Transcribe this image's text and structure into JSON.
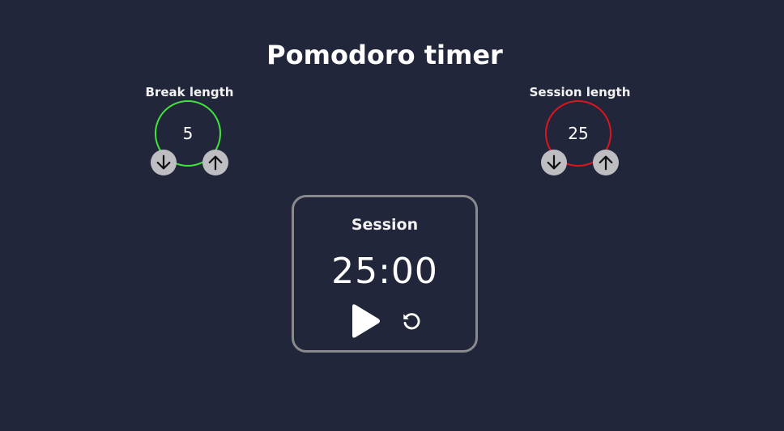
{
  "title": "Pomodoro timer",
  "break_control": {
    "label": "Break length",
    "value": "5",
    "ring_color": "#3fe63a",
    "decrement_icon": "arrow-down-icon",
    "increment_icon": "arrow-up-icon"
  },
  "session_control": {
    "label": "Session length",
    "value": "25",
    "ring_color": "#e0141c",
    "decrement_icon": "arrow-down-icon",
    "increment_icon": "arrow-up-icon"
  },
  "timer": {
    "label": "Session",
    "time": "25:00",
    "play_icon": "play-icon",
    "reset_icon": "reset-icon"
  },
  "colors": {
    "background": "#22263a",
    "button_gray": "#bdbdc2",
    "timer_border": "#8a8a8e"
  }
}
